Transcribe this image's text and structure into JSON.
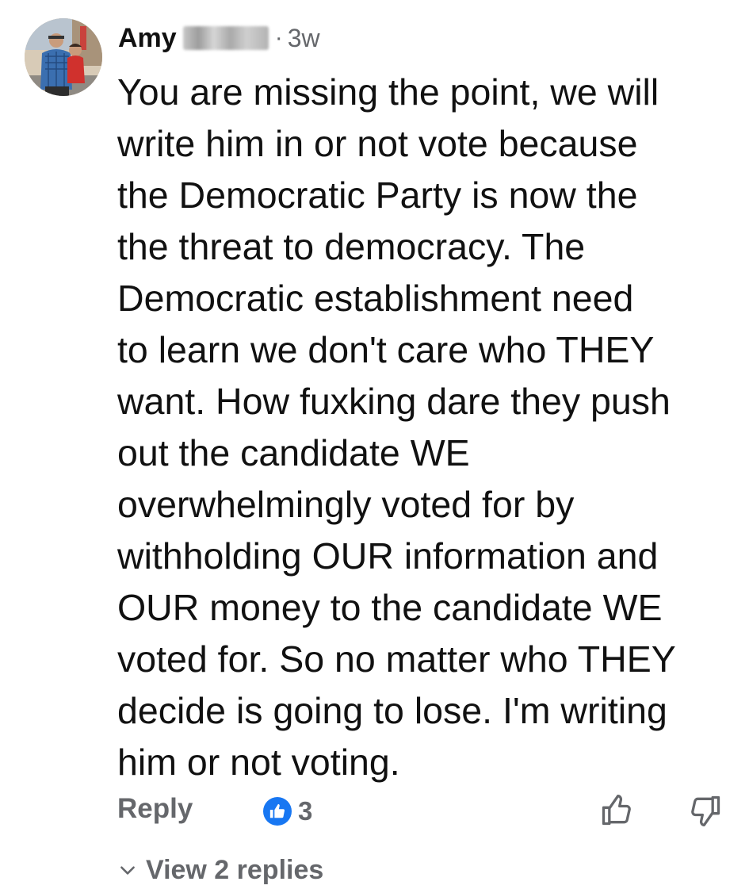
{
  "comment": {
    "author": "Amy",
    "separator": "·",
    "time": "3w",
    "text": "You are missing the point, we will\nwrite him in or not vote because\nthe Democratic Party is now the\nthe threat to democracy.  The\nDemocratic establishment need\nto learn we don't care who THEY\nwant. How fuxking dare they push\nout the candidate WE\noverwhelmingly voted for by\nwithholding OUR information and\nOUR money to the candidate WE\nvoted for. So no matter who THEY\ndecide is going to lose. I'm writing\nhim or not voting."
  },
  "actions": {
    "reply_label": "Reply",
    "reaction_count": "3",
    "reaction_icon": "like-icon",
    "like_icon": "thumbs-up-icon",
    "dislike_icon": "thumbs-down-icon"
  },
  "replies": {
    "label": "View 2 replies",
    "icon": "chevron-down-icon"
  },
  "colors": {
    "text": "#111111",
    "muted": "#65676b",
    "like_blue": "#1877f2",
    "background": "#ffffff"
  }
}
